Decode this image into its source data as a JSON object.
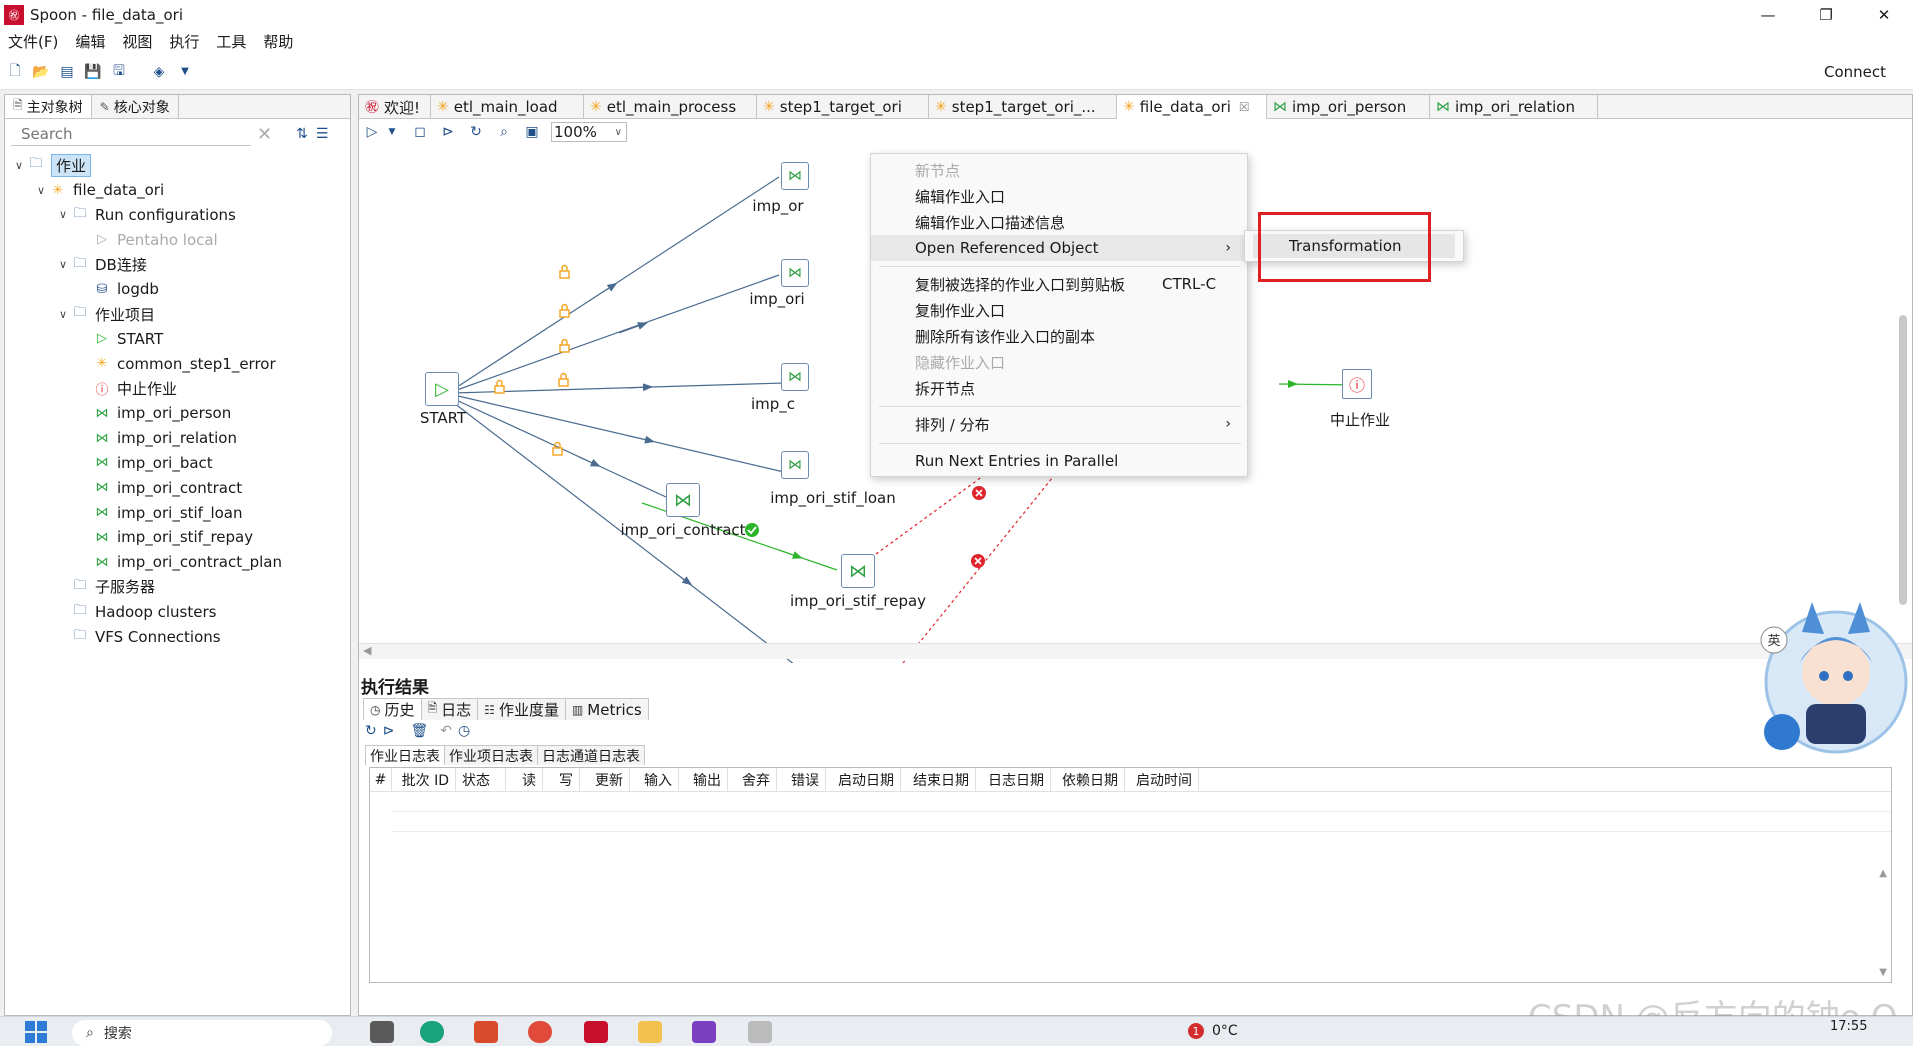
{
  "window": {
    "title": "Spoon - file_data_ori",
    "app_icon": "spoon-logo"
  },
  "menu": [
    "文件(F)",
    "编辑",
    "视图",
    "执行",
    "工具",
    "帮助"
  ],
  "toolbar": {
    "connect": "Connect"
  },
  "left_panel": {
    "tabs": [
      "主对象树",
      "核心对象"
    ],
    "search_placeholder": "Search",
    "tree": [
      {
        "label": "作业",
        "icon": "folder-icon",
        "selected": true
      },
      {
        "label": "file_data_ori",
        "icon": "job-icon"
      },
      {
        "label": "Run configurations",
        "icon": "folder-icon"
      },
      {
        "label": "Pentaho local",
        "icon": "run-icon",
        "disabled": true
      },
      {
        "label": "DB连接",
        "icon": "folder-icon"
      },
      {
        "label": "logdb",
        "icon": "database-icon"
      },
      {
        "label": "作业项目",
        "icon": "folder-icon"
      },
      {
        "label": "START",
        "icon": "start-icon"
      },
      {
        "label": "common_step1_error",
        "icon": "job-icon"
      },
      {
        "label": "中止作业",
        "icon": "abort-icon"
      },
      {
        "label": "imp_ori_person",
        "icon": "transformation-icon"
      },
      {
        "label": "imp_ori_relation",
        "icon": "transformation-icon"
      },
      {
        "label": "imp_ori_bact",
        "icon": "transformation-icon"
      },
      {
        "label": "imp_ori_contract",
        "icon": "transformation-icon"
      },
      {
        "label": "imp_ori_stif_loan",
        "icon": "transformation-icon"
      },
      {
        "label": "imp_ori_stif_repay",
        "icon": "transformation-icon"
      },
      {
        "label": "imp_ori_contract_plan",
        "icon": "transformation-icon"
      },
      {
        "label": "子服务器",
        "icon": "folder-icon"
      },
      {
        "label": "Hadoop clusters",
        "icon": "folder-icon"
      },
      {
        "label": "VFS Connections",
        "icon": "folder-icon"
      }
    ]
  },
  "file_tabs": [
    {
      "label": "欢迎!",
      "icon": "spoon-icon"
    },
    {
      "label": "etl_main_load",
      "icon": "job-icon"
    },
    {
      "label": "etl_main_process",
      "icon": "job-icon"
    },
    {
      "label": "step1_target_ori",
      "icon": "job-icon"
    },
    {
      "label": "step1_target_ori_...",
      "icon": "job-icon"
    },
    {
      "label": "file_data_ori",
      "icon": "job-icon",
      "active": true
    },
    {
      "label": "imp_ori_person",
      "icon": "transformation-icon"
    },
    {
      "label": "imp_ori_relation",
      "icon": "transformation-icon"
    }
  ],
  "zoom": "100%",
  "canvas": {
    "nodes": {
      "start": "START",
      "top": "imp_or",
      "second": "imp_ori",
      "third": "imp_c",
      "stif_loan": "imp_ori_stif_loan",
      "contract": "imp_ori_contract",
      "stif_repay": "imp_ori_stif_repay",
      "abort": "中止作业"
    }
  },
  "context_menu": {
    "items": [
      {
        "label": "新节点",
        "disabled": true
      },
      {
        "label": "编辑作业入口"
      },
      {
        "label": "编辑作业入口描述信息"
      },
      {
        "label": "Open Referenced Object",
        "submenu": true,
        "highlighted": true
      },
      {
        "label": "复制被选择的作业入口到剪贴板",
        "shortcut": "CTRL-C"
      },
      {
        "label": "复制作业入口"
      },
      {
        "label": "删除所有该作业入口的副本"
      },
      {
        "label": "隐藏作业入口",
        "disabled": true
      },
      {
        "label": "拆开节点"
      },
      {
        "label": "排列 / 分布",
        "submenu": true
      },
      {
        "label": "Run Next Entries in Parallel"
      }
    ],
    "submenu": {
      "item": "Transformation"
    }
  },
  "results": {
    "title": "执行结果",
    "tabs": [
      "历史",
      "日志",
      "作业度量",
      "Metrics"
    ],
    "log_tabs": [
      "作业日志表",
      "作业项日志表",
      "日志通道日志表"
    ],
    "columns": [
      "#",
      "批次 ID",
      "状态",
      "读",
      "写",
      "更新",
      "输入",
      "输出",
      "舍弃",
      "错误",
      "启动日期",
      "结束日期",
      "日志日期",
      "依赖日期",
      "启动时间"
    ]
  },
  "taskbar": {
    "search": "搜索",
    "temperature": "0°C",
    "notification_count": "1",
    "time": "17:55"
  },
  "watermark": "CSDN @反方向的钟o.O",
  "colors": {
    "hop": "#4a6a8f",
    "hop_success": "#2bb52b",
    "hop_error": "#e0242c",
    "lock": "#f3a21b",
    "highlight_box": "#e02020"
  }
}
